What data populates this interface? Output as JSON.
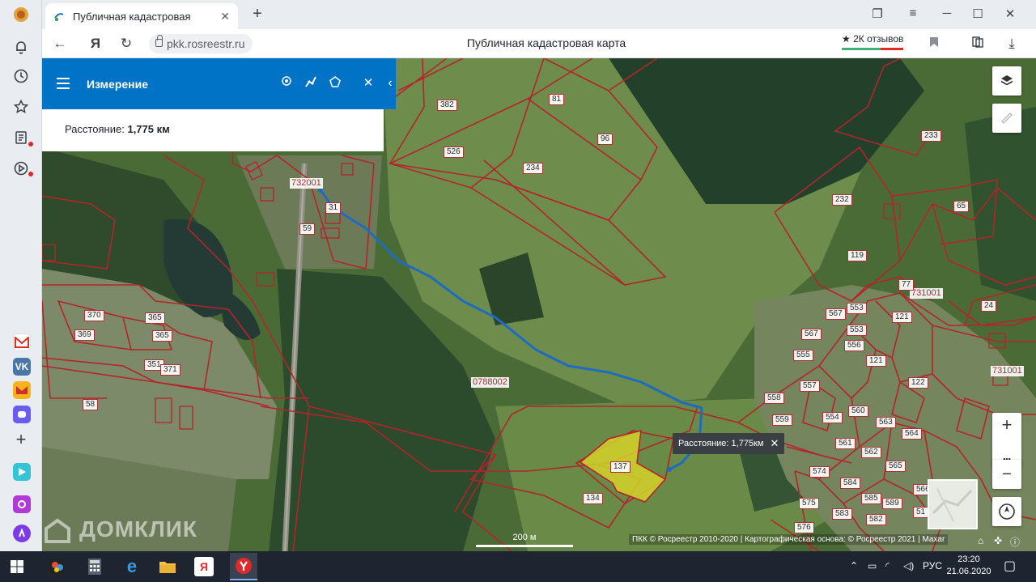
{
  "browser": {
    "tab_title": "Публичная кадастровая",
    "url": "pkk.rosreestr.ru",
    "page_title": "Публичная кадастровая карта",
    "reviews": "★ 2К отзывов",
    "nav_yandex": "Я"
  },
  "measure_panel": {
    "title": "Измерение",
    "result_label": "Расстояние:",
    "result_value": "1,775 км"
  },
  "tooltip": {
    "text": "Расстояние: 1,775км"
  },
  "map": {
    "quarters": [
      "732001",
      "731001",
      "731001",
      "0788002"
    ],
    "parcels": [
      "382",
      "81",
      "96",
      "526",
      "234",
      "233",
      "232",
      "65",
      "119",
      "370",
      "365",
      "369",
      "365",
      "351",
      "371",
      "58",
      "137",
      "134",
      "567",
      "553",
      "121",
      "567",
      "553",
      "555",
      "556",
      "121",
      "122",
      "24",
      "77",
      "557",
      "558",
      "559",
      "554",
      "560",
      "563",
      "564",
      "561",
      "562",
      "565",
      "566",
      "574",
      "584",
      "575",
      "583",
      "585",
      "589",
      "576",
      "582",
      "51",
      "59",
      "31"
    ],
    "scale_label": "200 м",
    "copyright": "ПКК © Росреестр 2010-2020 | Картографическая основа: © Росреестр 2021 | Maxar",
    "watermark": "ДОМКЛИК"
  },
  "map_controls": {
    "zoom_in": "+",
    "more": "•••",
    "zoom_out": "−"
  },
  "taskbar": {
    "lang": "РУС",
    "time": "23:20",
    "date": "21.06.2020",
    "yandex_label": "Я"
  }
}
